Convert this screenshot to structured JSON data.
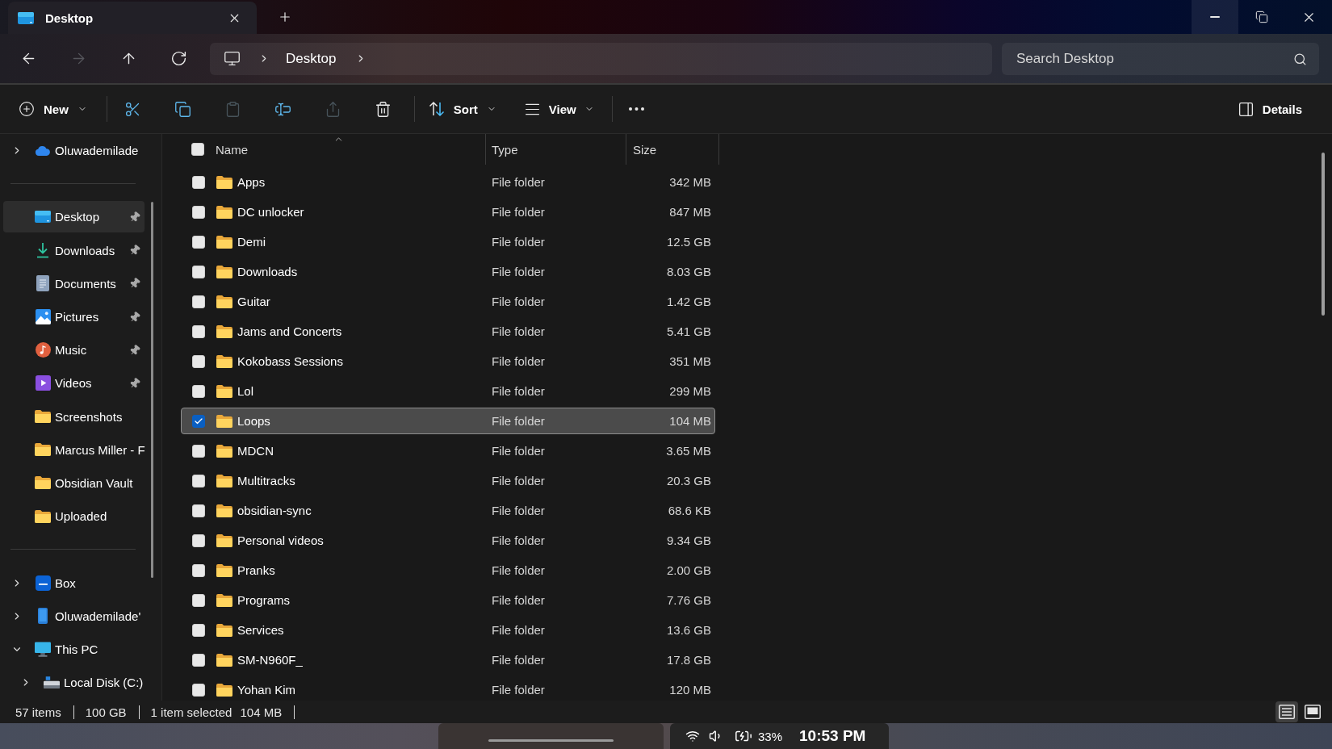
{
  "window": {
    "tab": {
      "title": "Desktop"
    },
    "controls": [
      {
        "kind": "minimize",
        "hovered": true
      },
      {
        "kind": "restore",
        "hovered": false
      },
      {
        "kind": "close",
        "hovered": false
      }
    ]
  },
  "nav_buttons": [
    {
      "kind": "back",
      "disabled": false
    },
    {
      "kind": "forward",
      "disabled": true
    },
    {
      "kind": "up",
      "disabled": false
    },
    {
      "kind": "refresh",
      "disabled": false
    }
  ],
  "address_bar": {
    "crumbs": [
      "Desktop"
    ]
  },
  "search": {
    "placeholder": "Search Desktop"
  },
  "toolbar": {
    "new": {
      "label": "New"
    },
    "actions": [
      {
        "kind": "cut",
        "disabled": false
      },
      {
        "kind": "copy",
        "disabled": false
      },
      {
        "kind": "paste",
        "disabled": true
      },
      {
        "kind": "rename",
        "disabled": false
      },
      {
        "kind": "share",
        "disabled": true
      },
      {
        "kind": "delete",
        "disabled": false
      }
    ],
    "sort": {
      "label": "Sort"
    },
    "view": {
      "label": "View"
    },
    "details": {
      "label": "Details"
    }
  },
  "sidebar": {
    "sections": [
      {
        "items": [
          {
            "label": "Oluwademilade",
            "kind": "cloud",
            "expanded": false,
            "selected": false
          }
        ]
      },
      {
        "items": [
          {
            "label": "Desktop",
            "kind": "desktop",
            "pinned": true,
            "selected": true
          },
          {
            "label": "Downloads",
            "kind": "download",
            "pinned": true,
            "selected": false
          },
          {
            "label": "Documents",
            "kind": "document",
            "pinned": true,
            "selected": false
          },
          {
            "label": "Pictures",
            "kind": "picture",
            "pinned": true,
            "selected": false
          },
          {
            "label": "Music",
            "kind": "music",
            "pinned": true,
            "selected": false
          },
          {
            "label": "Videos",
            "kind": "video",
            "pinned": true,
            "selected": false
          },
          {
            "label": "Screenshots",
            "kind": "folder",
            "pinned": false,
            "selected": false
          },
          {
            "label": "Marcus Miller - F",
            "kind": "folder",
            "pinned": false,
            "selected": false
          },
          {
            "label": "Obsidian Vault",
            "kind": "folder",
            "pinned": false,
            "selected": false
          },
          {
            "label": "Uploaded",
            "kind": "folder",
            "pinned": false,
            "selected": false
          }
        ]
      },
      {
        "items": [
          {
            "label": "Box",
            "kind": "app",
            "expanded": false,
            "selected": false
          },
          {
            "label": "Oluwademilade'",
            "kind": "phone",
            "expanded": false,
            "selected": false
          },
          {
            "label": "This PC",
            "kind": "pc",
            "expanded": true,
            "selected": false,
            "children": [
              {
                "label": "Local Disk (C:)",
                "kind": "drive",
                "expanded": false,
                "selected": false
              }
            ]
          }
        ]
      }
    ]
  },
  "table": {
    "select_all": {
      "checked": false
    },
    "columns": [
      {
        "label": "Name",
        "sorted": true
      },
      {
        "label": "Type",
        "sorted": false
      },
      {
        "label": "Size",
        "sorted": false
      }
    ],
    "rows": [
      {
        "name": "Apps",
        "type": "File folder",
        "size": "342 MB",
        "selected": false
      },
      {
        "name": "DC unlocker",
        "type": "File folder",
        "size": "847 MB",
        "selected": false
      },
      {
        "name": "Demi",
        "type": "File folder",
        "size": "12.5 GB",
        "selected": false
      },
      {
        "name": "Downloads",
        "type": "File folder",
        "size": "8.03 GB",
        "selected": false
      },
      {
        "name": "Guitar",
        "type": "File folder",
        "size": "1.42 GB",
        "selected": false
      },
      {
        "name": "Jams and Concerts",
        "type": "File folder",
        "size": "5.41 GB",
        "selected": false
      },
      {
        "name": "Kokobass Sessions",
        "type": "File folder",
        "size": "351 MB",
        "selected": false
      },
      {
        "name": "Lol",
        "type": "File folder",
        "size": "299 MB",
        "selected": false
      },
      {
        "name": "Loops",
        "type": "File folder",
        "size": "104 MB",
        "selected": true
      },
      {
        "name": "MDCN",
        "type": "File folder",
        "size": "3.65 MB",
        "selected": false
      },
      {
        "name": "Multitracks",
        "type": "File folder",
        "size": "20.3 GB",
        "selected": false
      },
      {
        "name": "obsidian-sync",
        "type": "File folder",
        "size": "68.6 KB",
        "selected": false
      },
      {
        "name": "Personal videos",
        "type": "File folder",
        "size": "9.34 GB",
        "selected": false
      },
      {
        "name": "Pranks",
        "type": "File folder",
        "size": "2.00 GB",
        "selected": false
      },
      {
        "name": "Programs",
        "type": "File folder",
        "size": "7.76 GB",
        "selected": false
      },
      {
        "name": "Services",
        "type": "File folder",
        "size": "13.6 GB",
        "selected": false
      },
      {
        "name": "SM-N960F_",
        "type": "File folder",
        "size": "17.8 GB",
        "selected": false
      },
      {
        "name": "Yohan Kim",
        "type": "File folder",
        "size": "120 MB",
        "selected": false
      }
    ]
  },
  "status_bar": {
    "segments": [
      {
        "texts": [
          "57 items"
        ]
      },
      {
        "texts": [
          "100 GB"
        ]
      },
      {
        "texts": [
          "1 item selected",
          "104 MB"
        ]
      }
    ],
    "view_modes": [
      {
        "kind": "details",
        "selected": true
      },
      {
        "kind": "tiles",
        "selected": false
      }
    ]
  },
  "taskbar": {
    "battery": "33%",
    "time": "10:53 PM"
  }
}
